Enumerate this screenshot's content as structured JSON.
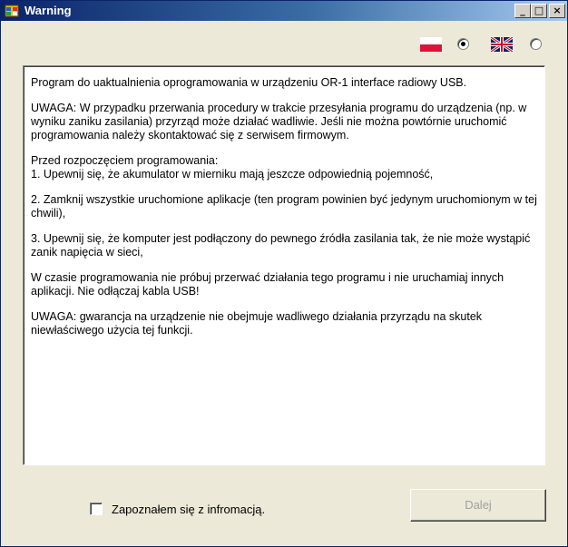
{
  "window": {
    "title": "Warning",
    "title_icon": "app-window-icon",
    "controls": {
      "minimize": "_",
      "maximize": "□",
      "close": "×"
    }
  },
  "language": {
    "options": [
      {
        "name": "polish",
        "icon": "poland-flag-icon",
        "selected": true
      },
      {
        "name": "english",
        "icon": "uk-flag-icon",
        "selected": false
      }
    ]
  },
  "message": {
    "paragraphs": [
      "Program do uaktualnienia oprogramowania w urządzeniu OR-1 interface radiowy USB.",
      "UWAGA: W przypadku przerwania procedury w trakcie przesyłania programu do urządzenia (np. w wyniku zaniku zasilania) przyrząd może działać wadliwie. Jeśli nie można powtórnie uruchomić programowania należy skontaktować się z serwisem firmowym.",
      "Przed rozpoczęciem programowania:\n1. Upewnij się, że akumulator w mierniku mają jeszcze odpowiednią pojemność,",
      "2. Zamknij wszystkie uruchomione aplikacje (ten program powinien być jedynym uruchomionym w tej chwili),",
      "3. Upewnij się, że komputer jest podłączony do pewnego źródła zasilania tak, że nie może wystąpić zanik napięcia w sieci,",
      "W czasie programowania nie próbuj przerwać działania tego programu i nie uruchamiaj innych aplikacji. Nie odłączaj kabla USB!",
      "UWAGA: gwarancja na urządzenie nie obejmuje wadliwego działania przyrządu na skutek niewłaściwego użycia tej funkcji."
    ]
  },
  "acknowledge": {
    "label": "Zapoznałem się z infromacją.",
    "checked": false
  },
  "next_button": {
    "label": "Dalej",
    "enabled": false
  },
  "colors": {
    "titlebar_start": "#0a246a",
    "titlebar_end": "#a6caf0",
    "window_bg": "#ece9d8",
    "disabled_text": "#a0a0a0"
  }
}
